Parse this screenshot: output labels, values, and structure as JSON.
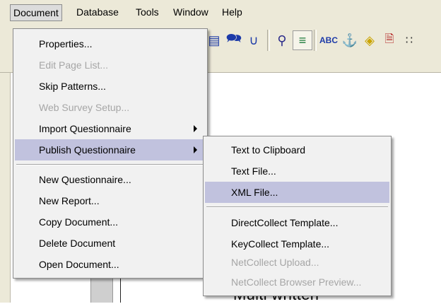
{
  "menubar": {
    "document": "Document",
    "database": "Database",
    "tools": "Tools",
    "window": "Window",
    "help": "Help"
  },
  "document_menu": {
    "properties": "Properties...",
    "edit_page_list": "Edit Page List...",
    "skip_patterns": "Skip Patterns...",
    "web_survey_setup": "Web Survey Setup...",
    "import_questionnaire": "Import Questionnaire",
    "publish_questionnaire": "Publish Questionnaire",
    "new_questionnaire": "New Questionnaire...",
    "new_report": "New Report...",
    "copy_document": "Copy Document...",
    "delete_document": "Delete Document",
    "open_document": "Open Document..."
  },
  "publish_submenu": {
    "text_to_clipboard": "Text to Clipboard",
    "text_file": "Text File...",
    "xml_file": "XML File...",
    "directcollect_template": "DirectCollect Template...",
    "keycollect_template": "KeyCollect Template...",
    "netcollect_upload": "NetCollect Upload...",
    "netcollect_browser_preview": "NetCollect Browser Preview..."
  },
  "toolbar_icons": [
    "select-box-icon",
    "speech-bubble-icon",
    "glasses-icon",
    "magnifier-icon",
    "tree-view-icon",
    "spellcheck-icon",
    "anchor-icon",
    "eraser-icon",
    "document-icon"
  ],
  "background": {
    "doc_text": "Multi written"
  },
  "colors": {
    "menu_highlight": "#c1c2de",
    "menu_bg": "#f1f1f1",
    "disabled_text": "#a6a6a6",
    "chrome": "#ece9d8"
  }
}
